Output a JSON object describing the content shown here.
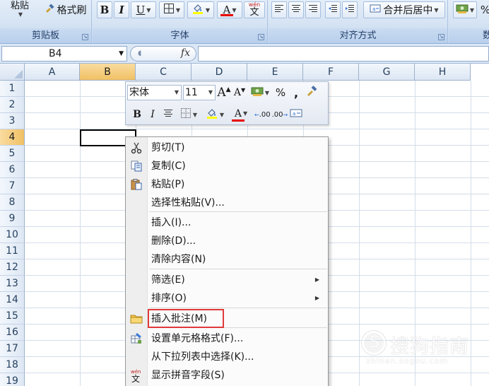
{
  "ribbon": {
    "clipboard": {
      "paste_label": "粘贴",
      "format_painter_label": "格式刷",
      "caption": "剪贴板"
    },
    "font": {
      "bold": "B",
      "italic": "I",
      "underline": "U",
      "font_color_glyph": "A",
      "phonetic_glyph": "wén",
      "phonetic_char": "文",
      "caption": "字体"
    },
    "alignment": {
      "merge_center_label": "合并后居中",
      "caption": "对齐方式"
    },
    "number": {
      "percent": "%",
      "caption": "数"
    }
  },
  "formula_bar": {
    "name_box": "B4",
    "fx_label": "fx",
    "formula": ""
  },
  "grid": {
    "columns": [
      "A",
      "B",
      "C",
      "D",
      "E",
      "F",
      "G",
      "H"
    ],
    "rows": [
      "1",
      "2",
      "3",
      "4",
      "5",
      "6",
      "7",
      "8",
      "9",
      "10",
      "11",
      "12",
      "13",
      "14",
      "15",
      "16",
      "17",
      "18",
      "19"
    ],
    "active_column": "B",
    "active_row": "4"
  },
  "mini_toolbar": {
    "font_name": "宋体",
    "font_size": "11",
    "grow_font": "A",
    "shrink_font": "A",
    "percent": "%",
    "comma": ",",
    "bold": "B",
    "italic": "I",
    "font_color_glyph": "A",
    "increase_decimal": ".00",
    "decrease_decimal": ".00"
  },
  "context_menu": {
    "items": [
      {
        "label": "剪切(T)",
        "icon": "scissors-icon"
      },
      {
        "label": "复制(C)",
        "icon": "copy-icon"
      },
      {
        "label": "粘贴(P)",
        "icon": "paste-icon"
      },
      {
        "label": "选择性粘贴(V)...",
        "icon": ""
      },
      {
        "label": "插入(I)...",
        "icon": ""
      },
      {
        "label": "删除(D)...",
        "icon": ""
      },
      {
        "label": "清除内容(N)",
        "icon": ""
      },
      {
        "label": "筛选(E)",
        "icon": "",
        "submenu": true
      },
      {
        "label": "排序(O)",
        "icon": "",
        "submenu": true
      },
      {
        "label": "插入批注(M)",
        "icon": "folder-icon"
      },
      {
        "label": "设置单元格格式(F)...",
        "icon": "format-cells-icon"
      },
      {
        "label": "从下拉列表中选择(K)...",
        "icon": ""
      },
      {
        "label": "显示拼音字段(S)",
        "icon": "phonetic-icon"
      }
    ],
    "highlighted": "插入批注(M)",
    "highlight_color": "#e03a3a"
  },
  "watermark": {
    "text": "搜狗指南",
    "sub": "zhinan.sogou.com"
  }
}
